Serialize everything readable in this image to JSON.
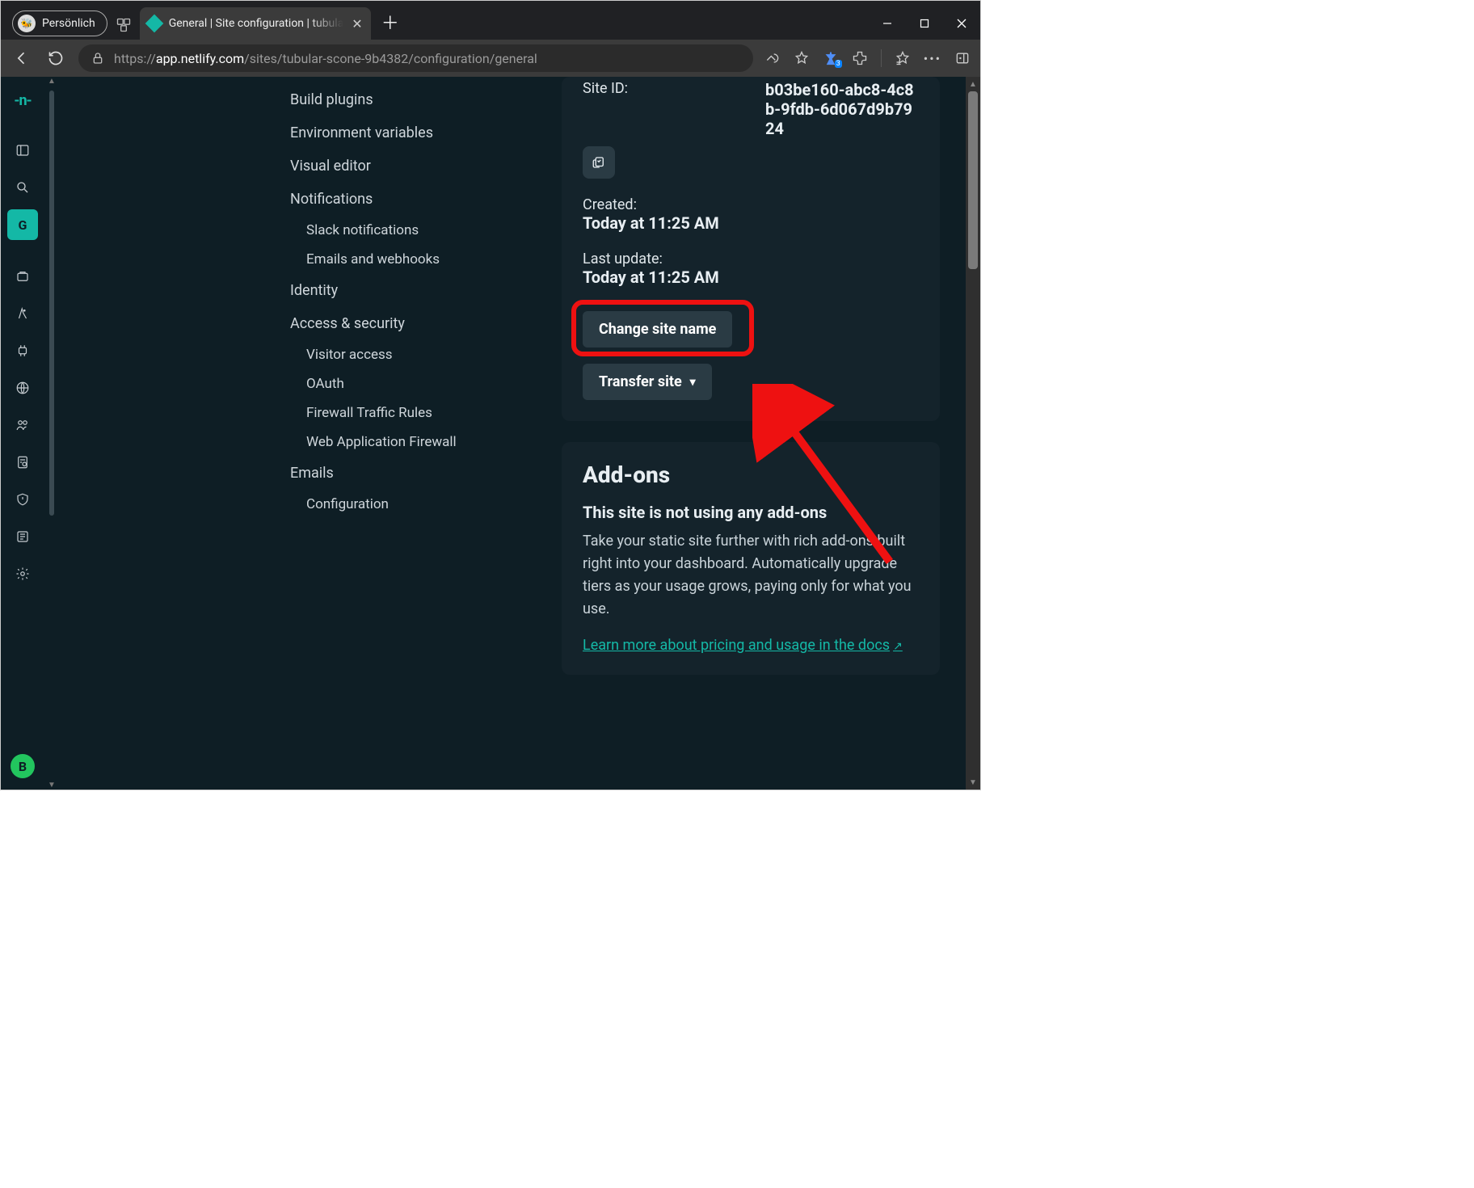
{
  "browser": {
    "profile_label": "Persönlich",
    "tab_title": "General | Site configuration | tubular-scone",
    "url_dim_prefix": "https://",
    "url_host": "app.netlify.com",
    "url_path": "/sites/tubular-scone-9b4382/configuration/general",
    "shopping_badge": "3"
  },
  "rail": {
    "logo_text": "-n-",
    "active_label": "G",
    "user_initial": "B"
  },
  "nav": {
    "build_plugins": "Build plugins",
    "env_vars": "Environment variables",
    "visual_editor": "Visual editor",
    "notifications": "Notifications",
    "slack": "Slack notifications",
    "emails_webhooks": "Emails and webhooks",
    "identity": "Identity",
    "access_security": "Access & security",
    "visitor_access": "Visitor access",
    "oauth": "OAuth",
    "firewall_rules": "Firewall Traffic Rules",
    "waf": "Web Application Firewall",
    "emails": "Emails",
    "configuration": "Configuration"
  },
  "info": {
    "site_id_label": "Site ID:",
    "site_id_value": "b03be160-abc8-4c8b-9fdb-6d067d9b7924",
    "created_label": "Created:",
    "created_value": "Today at 11:25 AM",
    "updated_label": "Last update:",
    "updated_value": "Today at 11:25 AM",
    "change_site_name": "Change site name",
    "transfer_site": "Transfer site"
  },
  "addons": {
    "heading": "Add-ons",
    "subheading": "This site is not using any add-ons",
    "desc": "Take your static site further with rich add-ons built right into your dashboard. Automatically upgrade tiers as your usage grows, paying only for what you use.",
    "learn_more": "Learn more about pricing and usage in the docs"
  }
}
